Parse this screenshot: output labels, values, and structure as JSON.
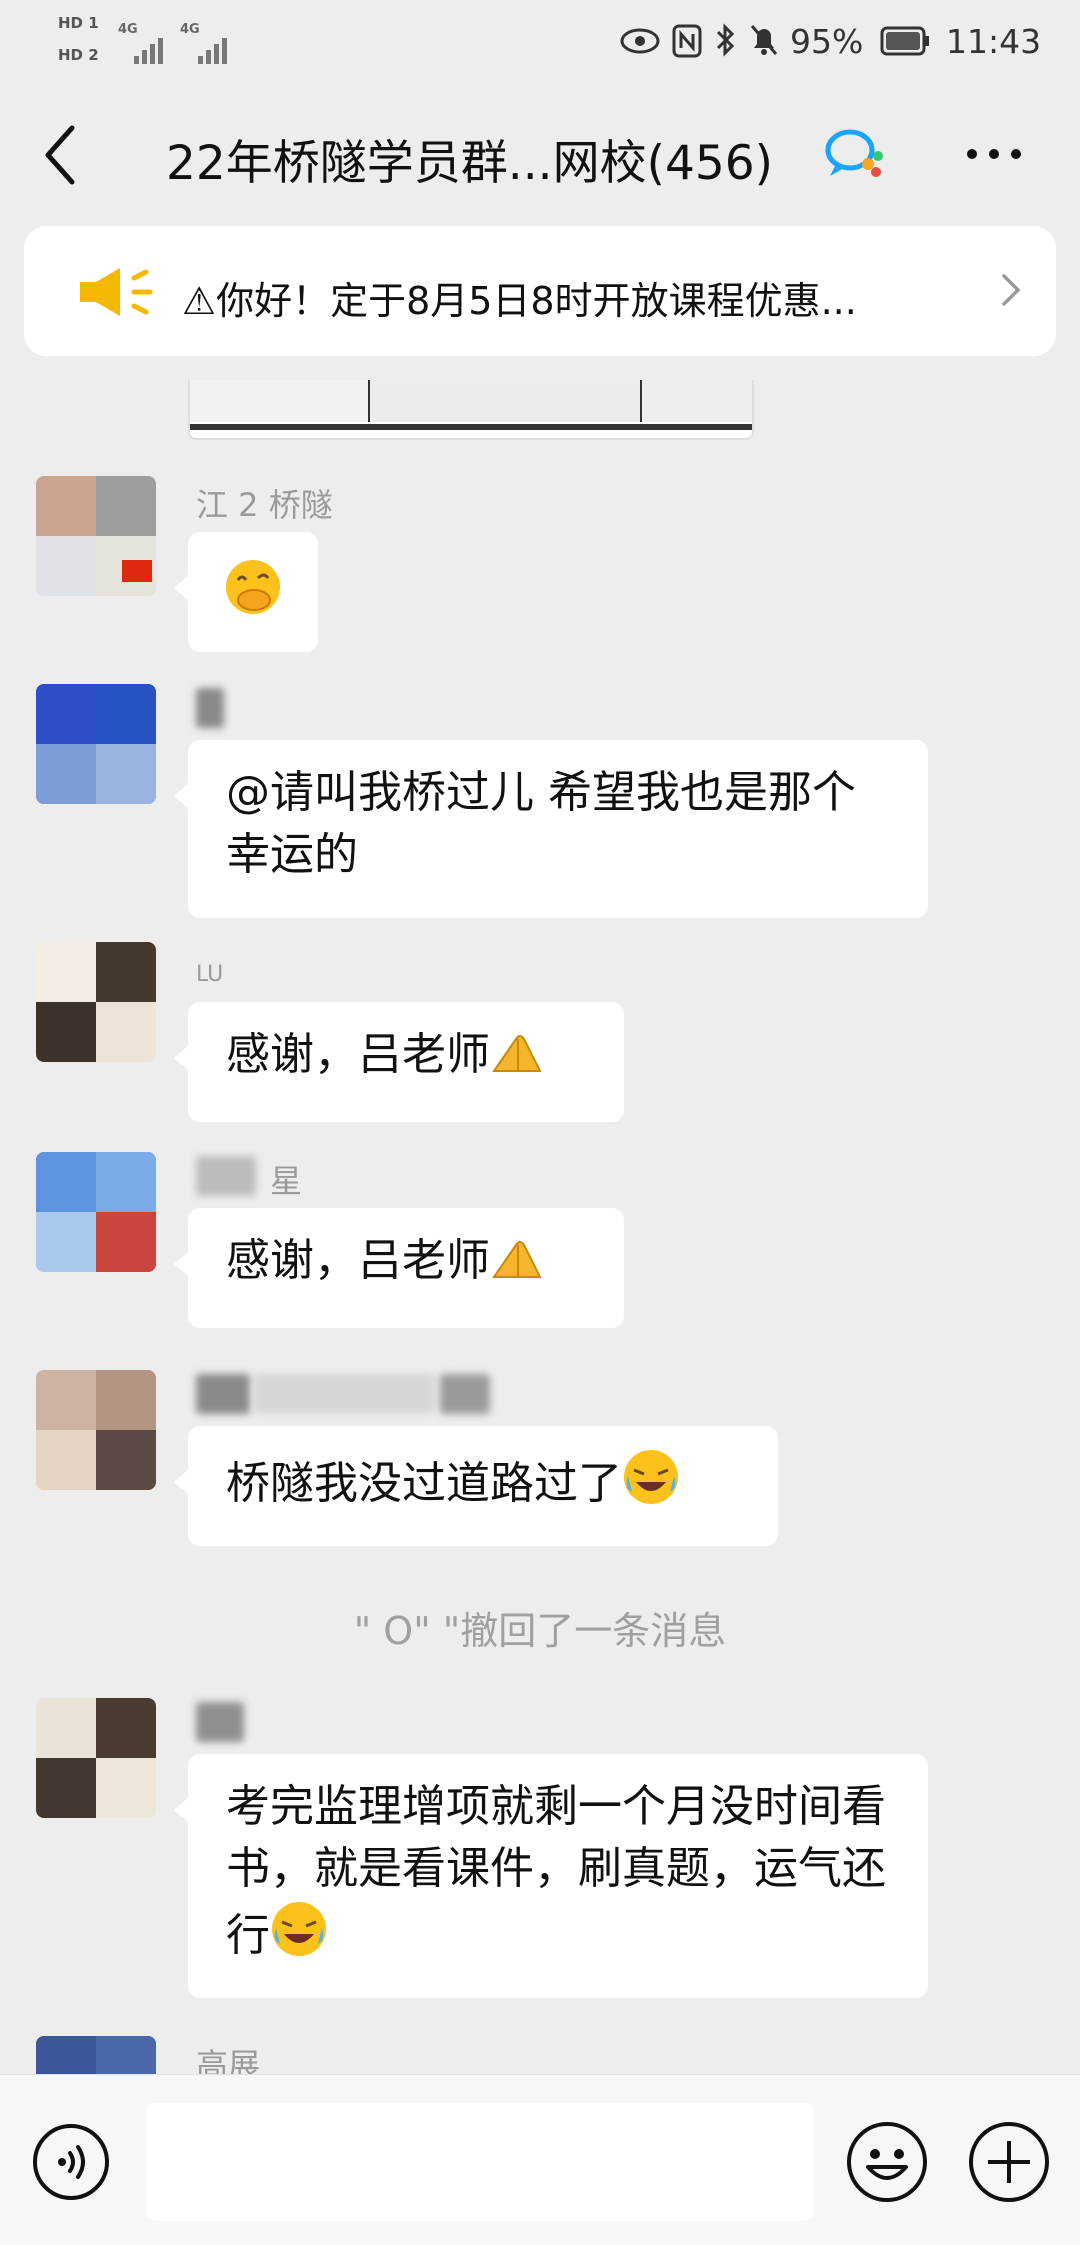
{
  "status_bar": {
    "hd1": "HD 1",
    "hd2": "HD 2",
    "net1": "4G",
    "net2": "4G",
    "battery": "95%",
    "time": "11:43"
  },
  "header": {
    "title": "22年桥隧学员群...网校(456)"
  },
  "announcement": {
    "text": "⚠你好！定于8月5日8时开放课程优惠..."
  },
  "messages": [
    {
      "sender": "江 2 桥隧",
      "text": ""
    },
    {
      "sender": "",
      "text": "@请叫我桥过儿  希望我也是那个幸运的"
    },
    {
      "sender": "LU",
      "text": "感谢，吕老师"
    },
    {
      "sender": "星",
      "text": "感谢，吕老师"
    },
    {
      "sender": "",
      "text": "桥隧我没过道路过了"
    },
    {
      "sender": "",
      "text": "考完监理增项就剩一个月没时间看书，就是看课件，刷真题，运气还行"
    },
    {
      "sender": "高展",
      "text": ""
    }
  ],
  "recall_notice": "\" O\" \"撤回了一条消息",
  "colors": {
    "background": "#ededed",
    "bubble": "#ffffff",
    "accent_speaker": "#f5b800",
    "badge_blue": "#1aa3ff"
  }
}
